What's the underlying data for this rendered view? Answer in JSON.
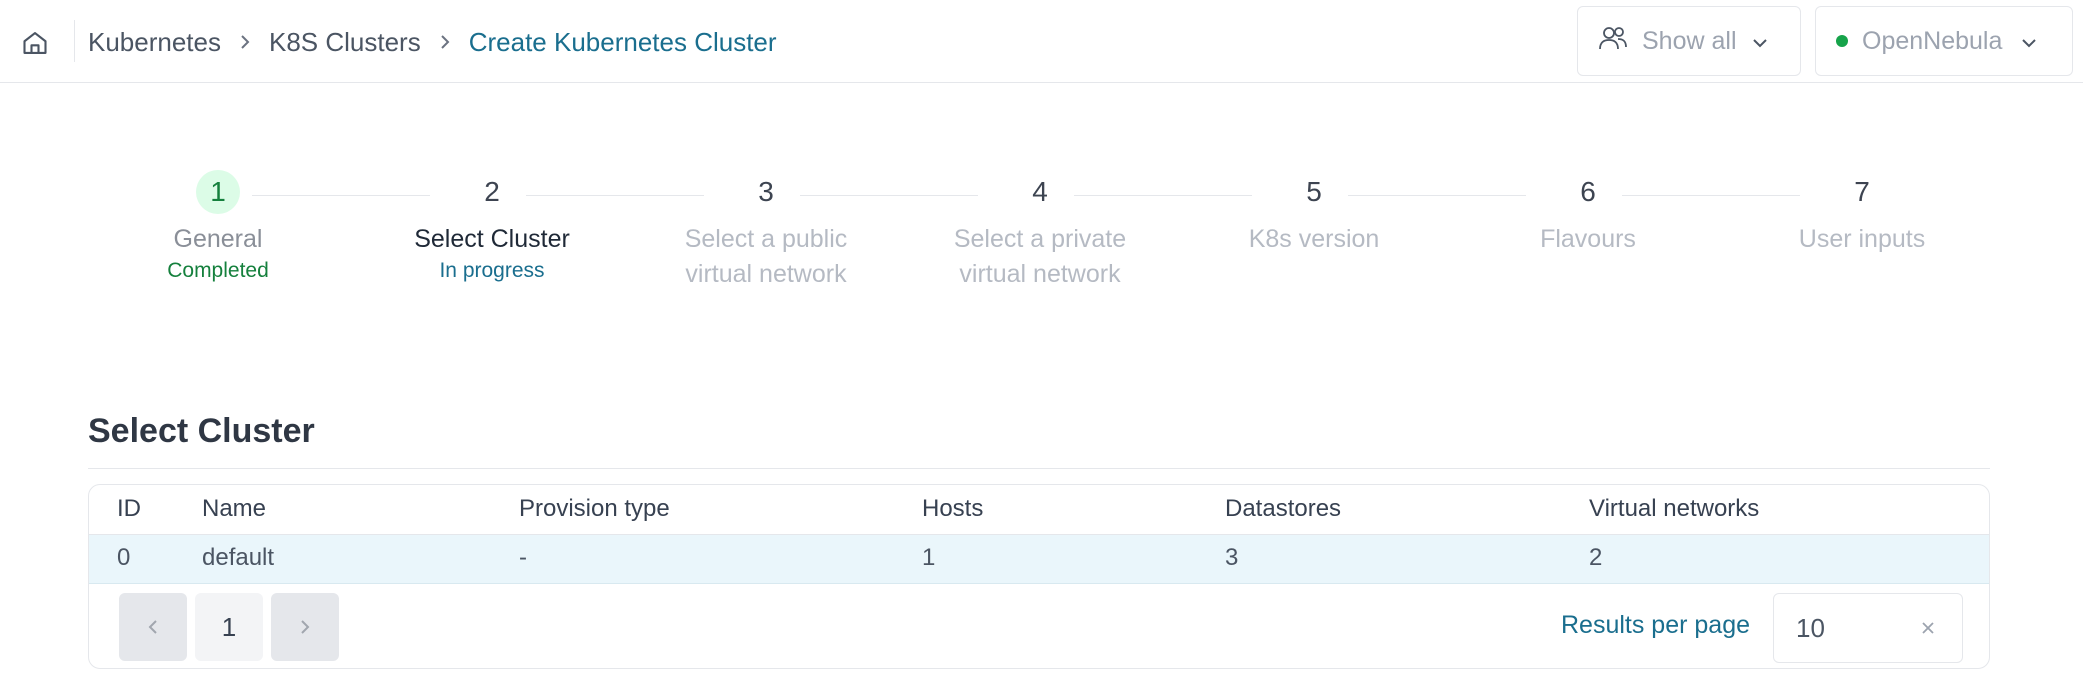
{
  "header": {
    "breadcrumb": [
      "Kubernetes",
      "K8S Clusters",
      "Create Kubernetes Cluster"
    ],
    "groups_filter": {
      "label": "Show all",
      "icon": "users-icon"
    },
    "zone_selector": {
      "label": "OpenNebula",
      "status_color": "#16a34a"
    }
  },
  "stepper": {
    "steps": [
      {
        "number": "1",
        "label": "General",
        "status": "Completed"
      },
      {
        "number": "2",
        "label": "Select Cluster",
        "status": "In progress"
      },
      {
        "number": "3",
        "label": "Select a public virtual network",
        "status": ""
      },
      {
        "number": "4",
        "label": "Select a private virtual network",
        "status": ""
      },
      {
        "number": "5",
        "label": "K8s version",
        "status": ""
      },
      {
        "number": "6",
        "label": "Flavours",
        "status": ""
      },
      {
        "number": "7",
        "label": "User inputs",
        "status": ""
      }
    ]
  },
  "section": {
    "title": "Select Cluster"
  },
  "table": {
    "columns": [
      "ID",
      "Name",
      "Provision type",
      "Hosts",
      "Datastores",
      "Virtual networks"
    ],
    "rows": [
      [
        "0",
        "default",
        "-",
        "1",
        "3",
        "2"
      ]
    ]
  },
  "pagination": {
    "current_page": "1",
    "results_label": "Results per page",
    "results_value": "10"
  },
  "colors": {
    "accent": "#1a6e8e",
    "completed": "#15803d",
    "selected_row": "#eaf6fb"
  }
}
